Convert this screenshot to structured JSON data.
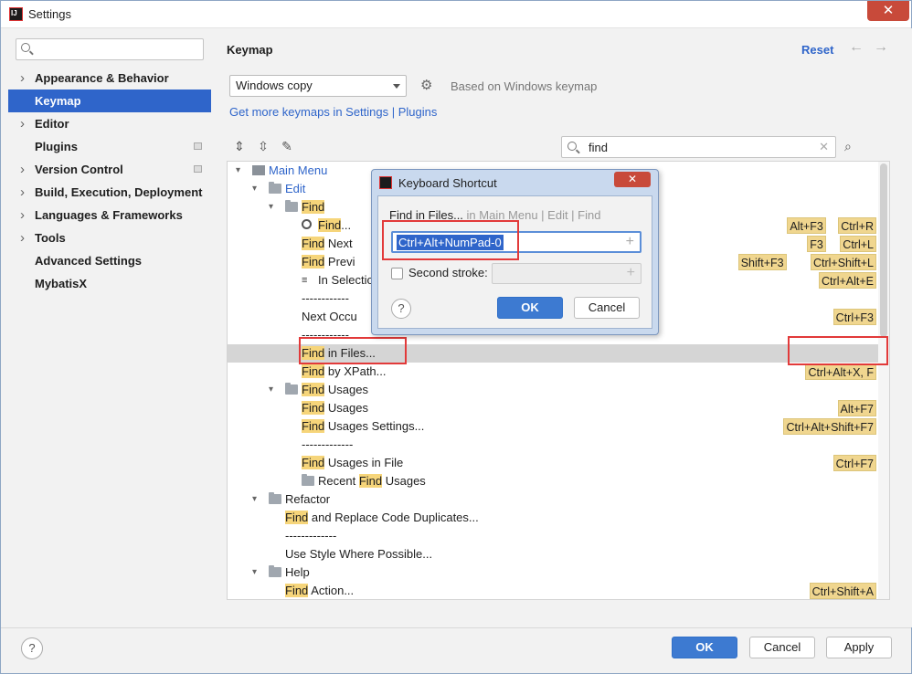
{
  "window": {
    "title": "Settings",
    "close_glyph": "✕"
  },
  "sidebar": {
    "search_placeholder": "",
    "items": [
      {
        "label": "Appearance & Behavior",
        "expandable": true
      },
      {
        "label": "Keymap",
        "selected": true
      },
      {
        "label": "Editor",
        "expandable": true
      },
      {
        "label": "Plugins",
        "badge": true
      },
      {
        "label": "Version Control",
        "expandable": true,
        "badge": true
      },
      {
        "label": "Build, Execution, Deployment",
        "expandable": true
      },
      {
        "label": "Languages & Frameworks",
        "expandable": true
      },
      {
        "label": "Tools",
        "expandable": true
      },
      {
        "label": "Advanced Settings"
      },
      {
        "label": "MybatisX"
      }
    ]
  },
  "main": {
    "title": "Keymap",
    "reset_label": "Reset",
    "back_glyph": "←",
    "forward_glyph": "→",
    "keymap_select_value": "Windows copy",
    "based_on": "Based on Windows keymap",
    "more_link": "Get more keymaps in Settings | Plugins",
    "find_value": "find",
    "find_clear": "✕"
  },
  "tree": {
    "rows": [
      {
        "indent": 0,
        "twisty": "▾",
        "icon": "menu",
        "parts": [
          {
            "t": "Main Menu"
          }
        ],
        "blue": true
      },
      {
        "indent": 1,
        "twisty": "▾",
        "icon": "folder",
        "parts": [
          {
            "t": "Edit"
          }
        ],
        "blue": true
      },
      {
        "indent": 2,
        "twisty": "▾",
        "icon": "folder",
        "parts": [
          {
            "t": "Find",
            "m": true
          }
        ]
      },
      {
        "indent": 3,
        "icon": "search",
        "parts": [
          {
            "t": "Find",
            "m": true
          },
          {
            "t": "..."
          }
        ],
        "shortcuts": [
          "Alt+F3",
          "Ctrl+R"
        ]
      },
      {
        "indent": 3,
        "parts": [
          {
            "t": "Find",
            "m": true
          },
          {
            "t": " Next"
          }
        ],
        "shortcuts": [
          "F3",
          "Ctrl+L"
        ]
      },
      {
        "indent": 3,
        "parts": [
          {
            "t": "Find",
            "m": true
          },
          {
            "t": " Previ"
          }
        ],
        "shortcuts": [
          "Shift+F3",
          "Ctrl+Shift+L"
        ]
      },
      {
        "indent": 3,
        "icon": "selection",
        "parts": [
          {
            "t": "In Selectio"
          }
        ],
        "shortcuts": [
          "Ctrl+Alt+E"
        ]
      },
      {
        "indent": 3,
        "parts": [
          {
            "t": "------------"
          }
        ]
      },
      {
        "indent": 3,
        "parts": [
          {
            "t": "Next Occu"
          }
        ],
        "shortcuts": [
          "Ctrl+F3"
        ]
      },
      {
        "indent": 3,
        "parts": [
          {
            "t": "------------"
          }
        ]
      },
      {
        "indent": 3,
        "parts": [
          {
            "t": "Find",
            "m": true
          },
          {
            "t": " in Files..."
          }
        ],
        "highlighted": true
      },
      {
        "indent": 3,
        "parts": [
          {
            "t": "Find",
            "m": true
          },
          {
            "t": " by XPath..."
          }
        ],
        "shortcuts": [
          "Ctrl+Alt+X, F"
        ]
      },
      {
        "indent": 2,
        "twisty": "▾",
        "icon": "folder",
        "parts": [
          {
            "t": "Find",
            "m": true
          },
          {
            "t": " Usages"
          }
        ]
      },
      {
        "indent": 3,
        "parts": [
          {
            "t": "Find",
            "m": true
          },
          {
            "t": " Usages"
          }
        ],
        "shortcuts": [
          "Alt+F7"
        ]
      },
      {
        "indent": 3,
        "parts": [
          {
            "t": "Find",
            "m": true
          },
          {
            "t": " Usages Settings..."
          }
        ],
        "shortcuts": [
          "Ctrl+Alt+Shift+F7"
        ]
      },
      {
        "indent": 3,
        "parts": [
          {
            "t": "-------------"
          }
        ]
      },
      {
        "indent": 3,
        "parts": [
          {
            "t": "Find",
            "m": true
          },
          {
            "t": " Usages in File"
          }
        ],
        "shortcuts": [
          "Ctrl+F7"
        ]
      },
      {
        "indent": 3,
        "icon": "folder",
        "parts": [
          {
            "t": "Recent "
          },
          {
            "t": "Find",
            "m": true
          },
          {
            "t": " Usages"
          }
        ]
      },
      {
        "indent": 1,
        "twisty": "▾",
        "icon": "folder",
        "parts": [
          {
            "t": "Refactor"
          }
        ]
      },
      {
        "indent": 2,
        "parts": [
          {
            "t": "Find",
            "m": true
          },
          {
            "t": " and Replace Code Duplicates..."
          }
        ]
      },
      {
        "indent": 2,
        "parts": [
          {
            "t": "-------------"
          }
        ]
      },
      {
        "indent": 2,
        "parts": [
          {
            "t": "Use Style Where Possible..."
          }
        ]
      },
      {
        "indent": 1,
        "twisty": "▾",
        "icon": "folder",
        "parts": [
          {
            "t": "Help"
          }
        ]
      },
      {
        "indent": 2,
        "parts": [
          {
            "t": "Find",
            "m": true
          },
          {
            "t": " Action..."
          }
        ],
        "shortcuts": [
          "Ctrl+Shift+A"
        ]
      }
    ]
  },
  "dialog": {
    "title": "Keyboard Shortcut",
    "close_glyph": "✕",
    "action_name": "Find in Files...",
    "action_path": " in Main Menu | Edit | Find",
    "first_stroke": "Ctrl+Alt+NumPad-0",
    "second_stroke_label": "Second stroke:",
    "second_stroke_checked": false,
    "plus_glyph": "+",
    "help_glyph": "?",
    "ok_label": "OK",
    "cancel_label": "Cancel"
  },
  "footer": {
    "help_glyph": "?",
    "ok_label": "OK",
    "cancel_label": "Cancel",
    "apply_label": "Apply"
  }
}
